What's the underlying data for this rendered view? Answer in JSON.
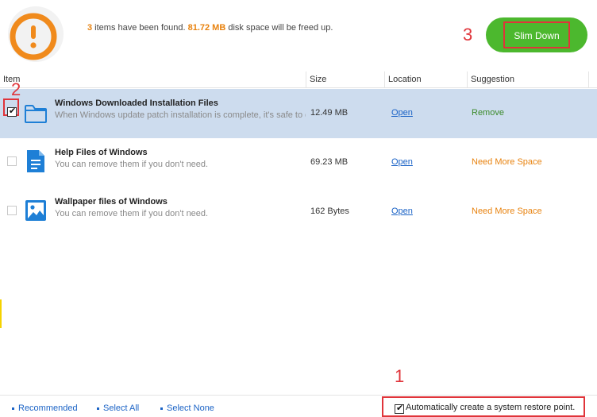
{
  "header": {
    "count": "3",
    "text_items": " items have been found. ",
    "space": "81.72 MB",
    "text_space": " disk space will be freed up.",
    "slim_down_label": "Slim Down",
    "warning_icon": "exclamation-circle-icon"
  },
  "annotations": {
    "one": "1",
    "two": "2",
    "three": "3"
  },
  "columns": {
    "item": "Item",
    "size": "Size",
    "location": "Location",
    "suggestion": "Suggestion"
  },
  "rows": [
    {
      "title": "Windows Downloaded Installation Files",
      "desc": "When Windows update patch installation is complete, it's safe to delete these files.",
      "size": "12.49 MB",
      "location": "Open",
      "suggestion": "Remove",
      "checked": true,
      "icon": "folder-icon"
    },
    {
      "title": "Help Files of Windows",
      "desc": "You can remove them if you don't need.",
      "size": "69.23 MB",
      "location": "Open",
      "suggestion": "Need More Space",
      "checked": false,
      "icon": "document-icon"
    },
    {
      "title": "Wallpaper files of Windows",
      "desc": "You can remove them if you don't need.",
      "size": "162 Bytes",
      "location": "Open",
      "suggestion": "Need More Space",
      "checked": false,
      "icon": "image-icon"
    }
  ],
  "footer": {
    "recommended": "Recommended",
    "select_all": "Select All",
    "select_none": "Select None",
    "restore_label": "Automatically create a system restore point.",
    "restore_checked": true
  },
  "colors": {
    "accent_orange": "#e8820e",
    "button_green": "#4cb82e",
    "highlight_red": "#e0343a",
    "link_blue": "#1b63c6",
    "selected_row": "#cddcee"
  }
}
